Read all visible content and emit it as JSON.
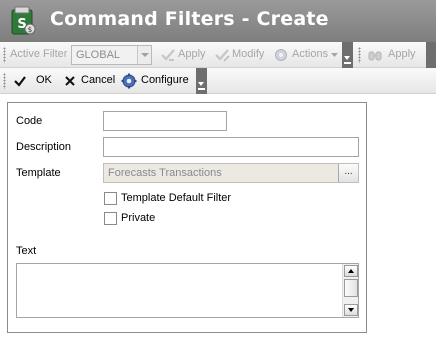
{
  "window": {
    "title": "Command Filters - Create"
  },
  "toolbar1": {
    "active_filter_label": "Active Filter",
    "active_filter_value": "GLOBAL",
    "apply_label": "Apply",
    "modify_label": "Modify",
    "actions_label": "Actions",
    "apply2_label": "Apply"
  },
  "toolbar2": {
    "ok_label": "OK",
    "cancel_label": "Cancel",
    "configure_label": "Configure"
  },
  "form": {
    "code_label": "Code",
    "code_value": "",
    "description_label": "Description",
    "description_value": "",
    "template_label": "Template",
    "template_value": "Forecasts Transactions",
    "template_browse": "...",
    "template_default_filter_label": "Template Default Filter",
    "template_default_filter_checked": false,
    "private_label": "Private",
    "private_checked": false,
    "text_label": "Text",
    "text_value": ""
  },
  "colors": {
    "titlebar": "#8a8a8a",
    "title_text": "#ffffff",
    "disabled_text": "#a6a6a6"
  }
}
